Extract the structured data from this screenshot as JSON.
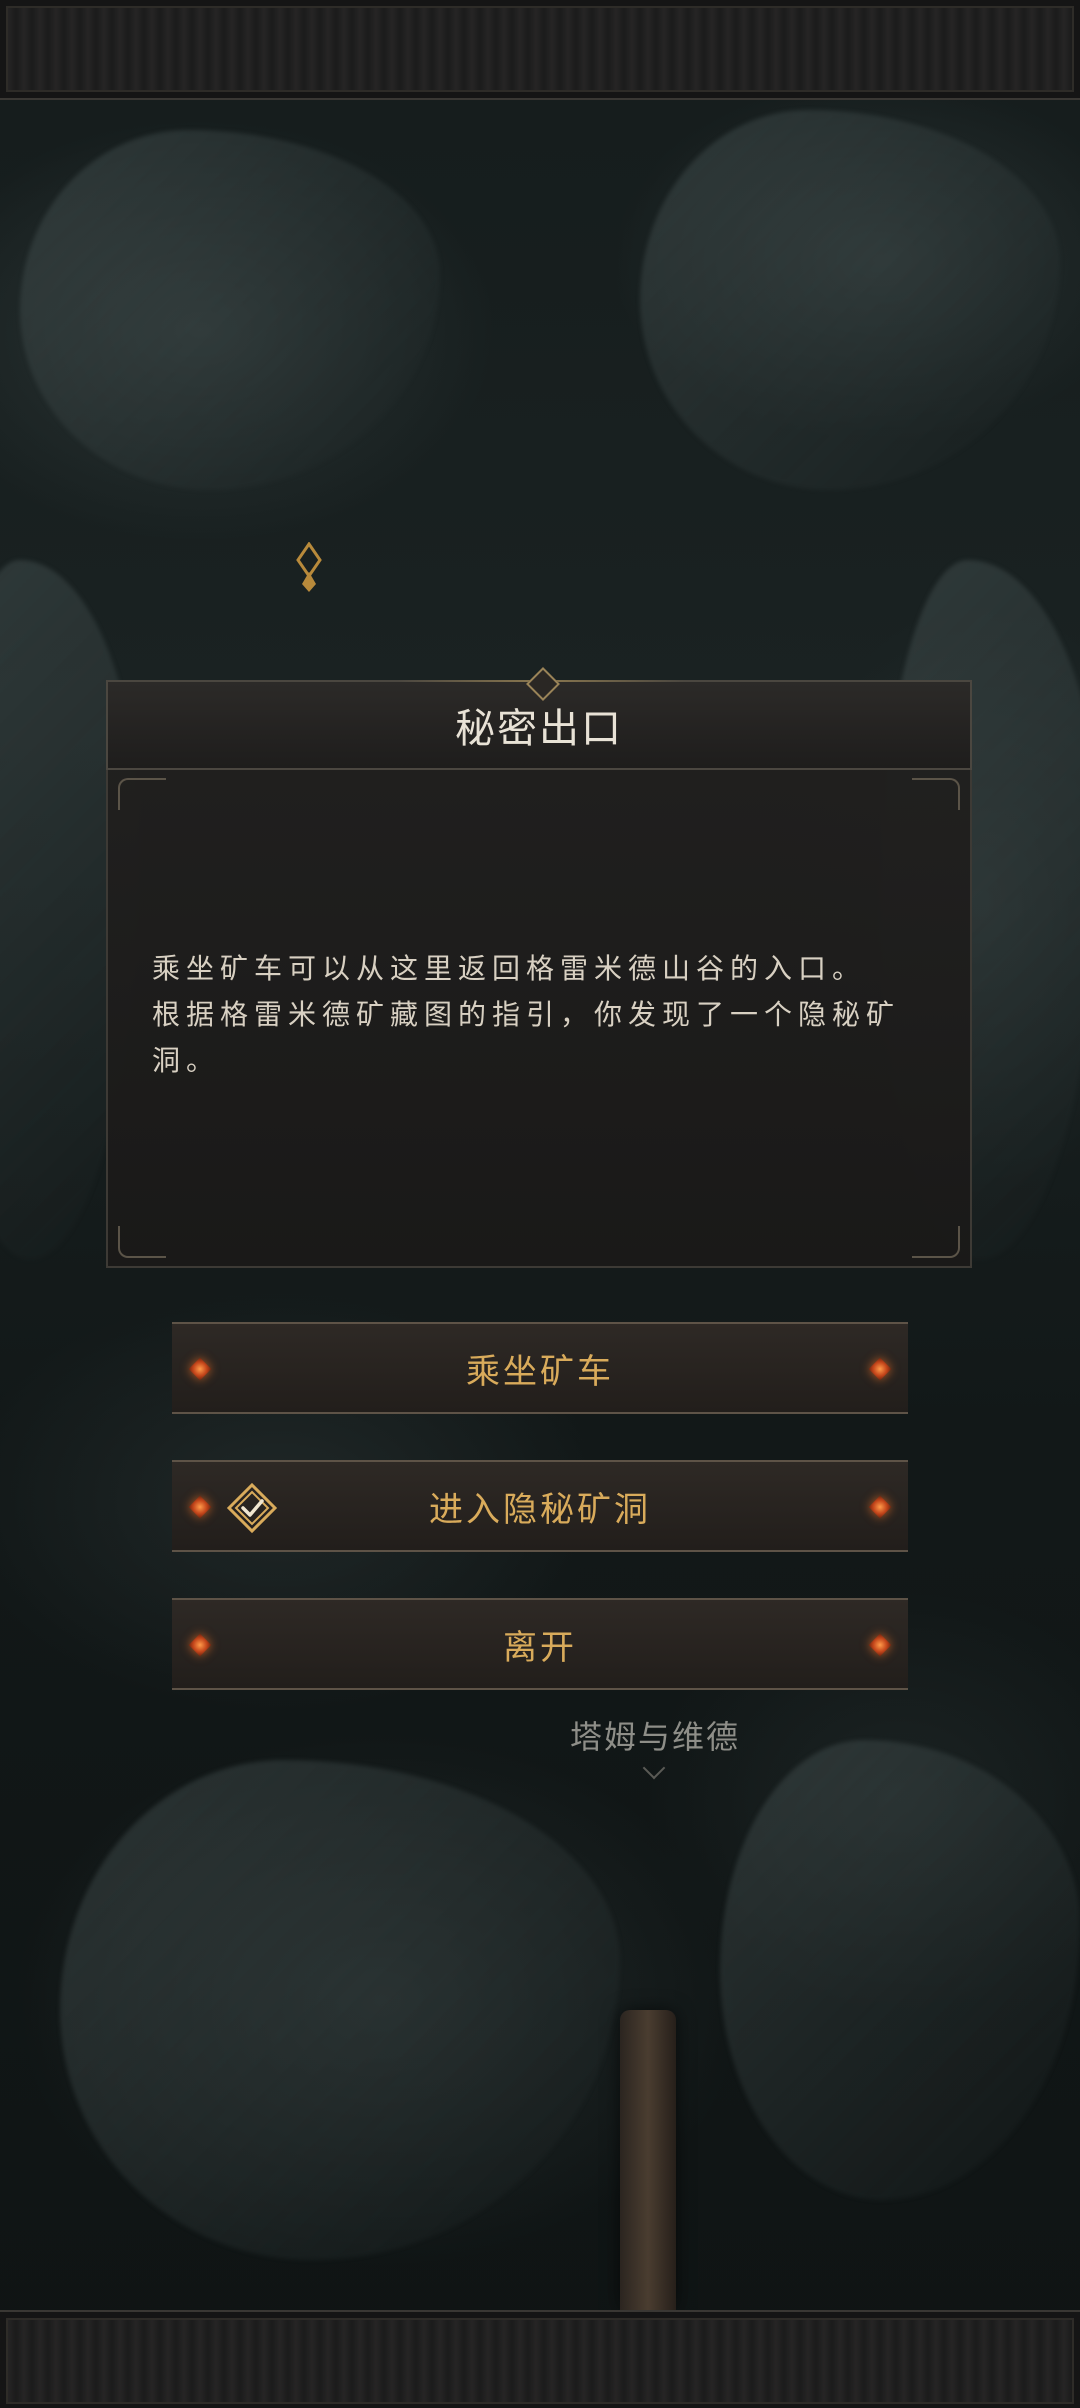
{
  "dialog": {
    "title": "秘密出口",
    "text_line_1": "乘坐矿车可以从这里返回格雷米德山谷的入口。",
    "text_line_2": "根据格雷米德矿藏图的指引，你发现了一个隐秘矿",
    "text_line_3": "洞。"
  },
  "choices": [
    {
      "label": "乘坐矿车",
      "icon": null
    },
    {
      "label": "进入隐秘矿洞",
      "icon": "checkmark-diamond-icon"
    },
    {
      "label": "离开",
      "icon": null
    }
  ],
  "map": {
    "location_label": "塔姆与维德"
  },
  "colors": {
    "accent_gold": "#d9ab5b",
    "gem_orange": "#ff7a2a",
    "text_light": "#e8e2d6"
  }
}
